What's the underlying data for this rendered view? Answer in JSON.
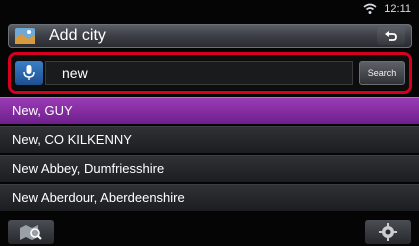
{
  "status": {
    "time": "12:11",
    "wifi_icon": "wifi-icon"
  },
  "header": {
    "title": "Add city",
    "app_icon": "map-icon",
    "back_icon": "back-arrow-icon"
  },
  "search": {
    "value": "new",
    "button_label": "Search",
    "mic_icon": "microphone-icon"
  },
  "results": [
    {
      "label": "New, GUY",
      "selected": true
    },
    {
      "label": "New, CO KILKENNY",
      "selected": false
    },
    {
      "label": "New Abbey, Dumfriesshire",
      "selected": false
    },
    {
      "label": "New Aberdour, Aberdeenshire",
      "selected": false
    }
  ],
  "footer": {
    "left_icon": "map-search-icon",
    "right_icon": "gear-icon"
  },
  "colors": {
    "highlight": "#d4001e",
    "selected_row": "#8a2ea8",
    "mic_button": "#2f6db3"
  }
}
